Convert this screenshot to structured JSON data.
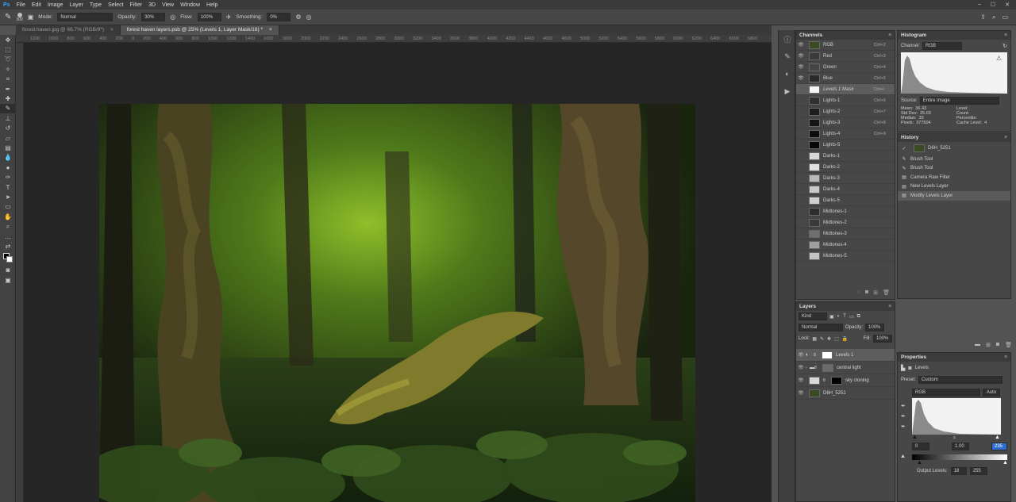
{
  "menubar": {
    "logo": "Ps",
    "items": [
      "File",
      "Edit",
      "Image",
      "Layer",
      "Type",
      "Select",
      "Filter",
      "3D",
      "View",
      "Window",
      "Help"
    ]
  },
  "options": {
    "brush_size": "300",
    "mode_label": "Mode:",
    "mode_value": "Normal",
    "opacity_label": "Opacity:",
    "opacity_value": "30%",
    "flow_label": "Flow:",
    "flow_value": "100%",
    "smoothing_label": "Smoothing:",
    "smoothing_value": "0%"
  },
  "tabs": [
    {
      "label": "forest haven.jpg @ 66.7% (RGB/8*)",
      "close": "×"
    },
    {
      "label": "forest haven layers.psb @ 25% (Levels 1, Layer Mask/16) *",
      "close": "×"
    }
  ],
  "ruler": [
    "1200",
    "1000",
    "800",
    "600",
    "400",
    "200",
    "0",
    "200",
    "400",
    "600",
    "800",
    "1000",
    "1200",
    "1400",
    "1600",
    "1800",
    "2000",
    "2200",
    "2400",
    "2600",
    "2800",
    "3000",
    "3200",
    "3400",
    "3600",
    "3800",
    "4000",
    "4200",
    "4400",
    "4600",
    "4800",
    "5000",
    "5200",
    "5400",
    "5600",
    "5800",
    "6000",
    "6200",
    "6400",
    "6600",
    "6800"
  ],
  "channels": {
    "title": "Channels",
    "rows": [
      {
        "name": "RGB",
        "key": "Ctrl+2",
        "thumb": "#3a4a22",
        "eye": true
      },
      {
        "name": "Red",
        "key": "Ctrl+3",
        "thumb": "#3a3a3a",
        "eye": true
      },
      {
        "name": "Green",
        "key": "Ctrl+4",
        "thumb": "#454545",
        "eye": true
      },
      {
        "name": "Blue",
        "key": "Ctrl+5",
        "thumb": "#2a2a2a",
        "eye": true
      },
      {
        "name": "Levels 1 Mask",
        "key": "Ctrl+\\",
        "thumb": "#f4f4f4",
        "eye": false,
        "selected": true
      },
      {
        "name": "Lights-1",
        "key": "Ctrl+6",
        "thumb": "#303030"
      },
      {
        "name": "Lights-2",
        "key": "Ctrl+7",
        "thumb": "#1d1d1d"
      },
      {
        "name": "Lights-3",
        "key": "Ctrl+8",
        "thumb": "#151515"
      },
      {
        "name": "Lights-4",
        "key": "Ctrl+9",
        "thumb": "#0d0d0d"
      },
      {
        "name": "Lights-5",
        "key": "",
        "thumb": "#080808"
      },
      {
        "name": "Darks-1",
        "key": "",
        "thumb": "#d8d8d8"
      },
      {
        "name": "Darks-2",
        "key": "",
        "thumb": "#e2e2e2"
      },
      {
        "name": "Darks-3",
        "key": "",
        "thumb": "#b8b8b8"
      },
      {
        "name": "Darks-4",
        "key": "",
        "thumb": "#c8c8c8"
      },
      {
        "name": "Darks-5",
        "key": "",
        "thumb": "#d0d0d0"
      },
      {
        "name": "Midtones-1",
        "key": "",
        "thumb": "#2e2e2e"
      },
      {
        "name": "Midtones-2",
        "key": "",
        "thumb": "#3a3a3a"
      },
      {
        "name": "Midtones-3",
        "key": "",
        "thumb": "#707070"
      },
      {
        "name": "Midtones-4",
        "key": "",
        "thumb": "#a0a0a0"
      },
      {
        "name": "Midtones-5",
        "key": "",
        "thumb": "#c4c4c4"
      }
    ]
  },
  "histogram": {
    "title": "Histogram",
    "channel_label": "Channel:",
    "channel_value": "RGB",
    "source_label": "Source:",
    "source_value": "Entire Image",
    "stats": [
      {
        "k": "Mean:",
        "v": "36.43"
      },
      {
        "k": "Std Dev:",
        "v": "25.03"
      },
      {
        "k": "Median:",
        "v": "33"
      },
      {
        "k": "Pixels:",
        "v": "377504"
      }
    ],
    "stats_right": [
      {
        "k": "Level:",
        "v": ""
      },
      {
        "k": "Count:",
        "v": ""
      },
      {
        "k": "Percentile:",
        "v": ""
      },
      {
        "k": "Cache Level:",
        "v": "4"
      }
    ]
  },
  "history": {
    "title": "History",
    "snapshot": "D6H_5251",
    "items": [
      {
        "label": "Brush Tool",
        "icon": "brush-icon"
      },
      {
        "label": "Brush Tool",
        "icon": "brush-icon"
      },
      {
        "label": "Camera Raw Filter",
        "icon": "filter-icon"
      },
      {
        "label": "New Levels Layer",
        "icon": "layer-icon"
      },
      {
        "label": "Modify Levels Layer",
        "icon": "layer-icon",
        "selected": true
      }
    ]
  },
  "layers": {
    "title": "Layers",
    "filter_value": "Kind",
    "blend_value": "Normal",
    "opacity_label": "Opacity:",
    "opacity_value": "100%",
    "lock_label": "Lock:",
    "fill_label": "Fill:",
    "fill_value": "100%",
    "rows": [
      {
        "name": "Levels 1",
        "selected": true
      },
      {
        "name": "central light"
      },
      {
        "name": "sky cloning"
      },
      {
        "name": "D6H_5251"
      }
    ]
  },
  "properties": {
    "title": "Properties",
    "panel_name": "Levels",
    "preset_label": "Preset:",
    "preset_value": "Custom",
    "channel_value": "RGB",
    "auto_label": "Auto",
    "input_black": "0",
    "input_gamma": "1.00",
    "input_white": "235",
    "output_label": "Output Levels:",
    "output_black": "18",
    "output_white": "255"
  }
}
